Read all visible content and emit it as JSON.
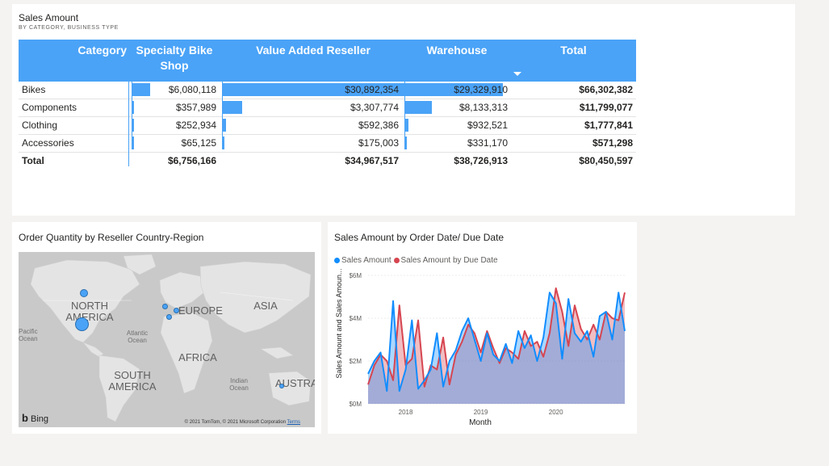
{
  "matrix": {
    "title": "Sales Amount",
    "subtitle": "BY CATEGORY, BUSINESS TYPE",
    "headers": {
      "category": "Category",
      "specialty": "Specialty Bike Shop",
      "var": "Value Added Reseller",
      "warehouse": "Warehouse",
      "total": "Total"
    },
    "rows": [
      {
        "category": "Bikes",
        "specialty": "$6,080,118",
        "var": "$30,892,354",
        "warehouse": "$29,329,910",
        "total": "$66,302,382"
      },
      {
        "category": "Components",
        "specialty": "$357,989",
        "var": "$3,307,774",
        "warehouse": "$8,133,313",
        "total": "$11,799,077"
      },
      {
        "category": "Clothing",
        "specialty": "$252,934",
        "var": "$592,386",
        "warehouse": "$932,521",
        "total": "$1,777,841"
      },
      {
        "category": "Accessories",
        "specialty": "$65,125",
        "var": "$175,003",
        "warehouse": "$331,170",
        "total": "$571,298"
      }
    ],
    "totals": {
      "category": "Total",
      "specialty": "$6,756,166",
      "var": "$34,967,517",
      "warehouse": "$38,726,913",
      "total": "$80,450,597"
    },
    "bar_fractions": {
      "specialty": [
        0.1968,
        0.0116,
        0.0082,
        0.0021
      ],
      "var": [
        1.0,
        0.1071,
        0.0192,
        0.0057
      ],
      "warehouse": [
        0.9494,
        0.2633,
        0.0302,
        0.0107
      ]
    },
    "accent_color": "#4aa3f7"
  },
  "map": {
    "title": "Order Quantity by Reseller Country-Region",
    "labels": {
      "north_america": "NORTH AMERICA",
      "south_america": "SOUTH AMERICA",
      "europe": "EUROPE",
      "asia": "ASIA",
      "africa": "AFRICA",
      "australia": "AUSTRA",
      "pacific": "Pacific Ocean",
      "atlantic": "Atlantic Ocean",
      "indian": "Indian Ocean"
    },
    "brand": "Bing",
    "brand_icon": "bing-logo-icon",
    "copyright": "© 2021 TomTom, © 2021 Microsoft Corporation",
    "terms_link": "Terms"
  },
  "line_chart": {
    "title": "Sales Amount by Order Date/ Due Date",
    "chart_data": {
      "type": "area",
      "xlabel": "Month",
      "ylabel": "Sales Amount and Sales Amoun...",
      "ylim": [
        0,
        6
      ],
      "y_ticks": [
        "$0M",
        "$2M",
        "$4M",
        "$6M"
      ],
      "x_ticks": [
        "2018",
        "2019",
        "2020"
      ],
      "series": [
        {
          "name": "Sales Amount",
          "color": "#118dff",
          "values": [
            1.4,
            2.0,
            2.4,
            0.6,
            4.8,
            0.6,
            1.6,
            3.9,
            0.7,
            1.1,
            1.6,
            3.3,
            0.8,
            2.0,
            2.5,
            3.4,
            4.0,
            3.0,
            2.0,
            3.3,
            2.3,
            2.0,
            2.8,
            1.9,
            3.4,
            2.6,
            3.2,
            2.0,
            3.1,
            5.2,
            4.7,
            2.1,
            4.9,
            3.3,
            2.9,
            3.4,
            2.2,
            4.1,
            4.3,
            3.0,
            5.2,
            3.4
          ]
        },
        {
          "name": "Sales Amount by Due Date",
          "color": "#d64550",
          "values": [
            0.9,
            1.8,
            2.3,
            2.0,
            1.1,
            4.6,
            1.8,
            2.1,
            3.9,
            0.8,
            1.8,
            1.6,
            3.1,
            0.9,
            2.3,
            2.9,
            3.7,
            3.3,
            2.4,
            3.4,
            2.6,
            1.9,
            2.6,
            2.4,
            2.1,
            3.4,
            2.7,
            2.9,
            2.2,
            3.3,
            5.4,
            4.3,
            2.7,
            4.6,
            3.5,
            3.0,
            3.7,
            3.0,
            4.3,
            4.0,
            3.9,
            5.2
          ]
        }
      ]
    }
  }
}
